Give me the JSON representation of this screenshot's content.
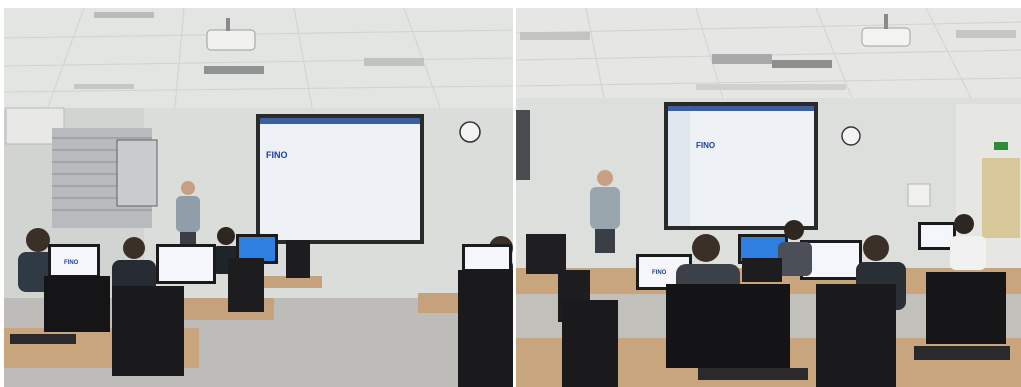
{
  "photos": [
    {
      "screen_logo": "FINO",
      "monitor_logo": "FINO"
    },
    {
      "screen_logo": "FINO",
      "monitor_logo": "FINO"
    }
  ],
  "colors": {
    "ceiling": "#e4e6e4",
    "wall": "#dcdedb",
    "projection": "#eef2f6",
    "desk": "#c9a57e",
    "pc": "#1a1a1c",
    "monitor_screen_blue": "#2f7fe0",
    "monitor_screen_white": "#f4f6fb"
  }
}
